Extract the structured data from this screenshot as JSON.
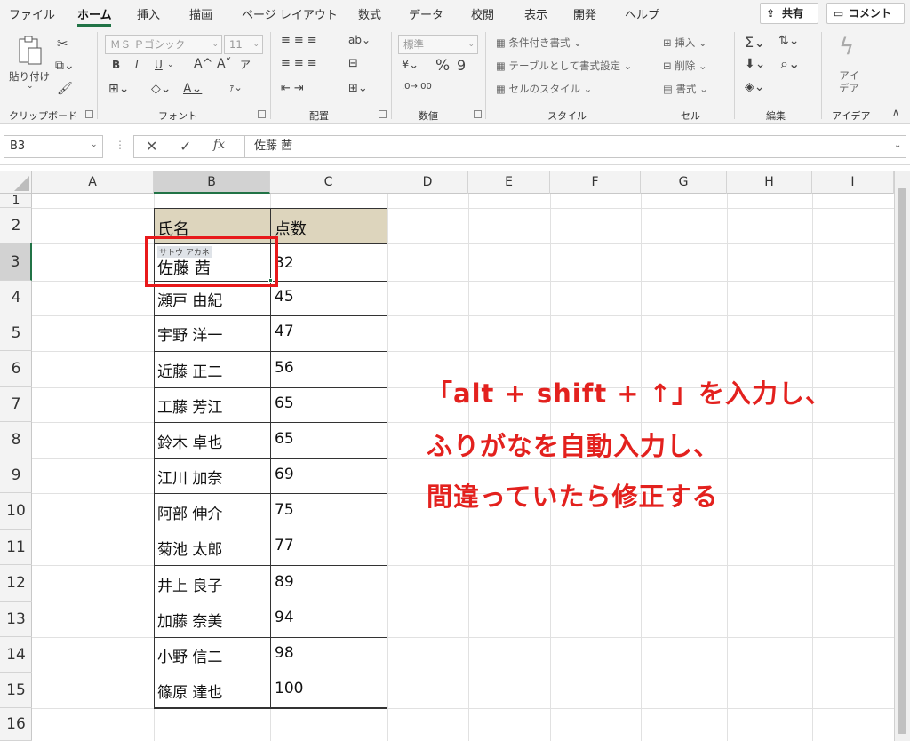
{
  "ribbon_tabs": [
    "ファイル",
    "ホーム",
    "挿入",
    "描画",
    "ページ レイアウト",
    "数式",
    "データ",
    "校閲",
    "表示",
    "開発",
    "ヘルプ"
  ],
  "share_button": "共有",
  "comment_button": "コメント",
  "clipboard": {
    "paste": "貼り付け",
    "label": "クリップボード"
  },
  "font_group": {
    "font_name": "ＭＳ Ｐゴシック",
    "font_size": "11",
    "label": "フォント",
    "bold": "B",
    "italic": "I",
    "underline": "U",
    "grow": "A^",
    "shrink": "Aˇ"
  },
  "alignment_group": {
    "label": "配置"
  },
  "number_group": {
    "format": "標準",
    "label": "数値",
    "percent": "%",
    "comma": "9"
  },
  "styles_group": {
    "conditional": "条件付き書式",
    "table": "テーブルとして書式設定",
    "cell_styles": "セルのスタイル",
    "label": "スタイル"
  },
  "cells_group": {
    "insert": "挿入",
    "delete": "削除",
    "format": "書式",
    "label": "セル"
  },
  "edit_group": {
    "label": "編集"
  },
  "ideas_group": {
    "button": "アイ\nデア",
    "label": "アイデア"
  },
  "formula_bar": {
    "name_box": "B3",
    "fx": "fx",
    "content": "佐藤 茜"
  },
  "columns": [
    "A",
    "B",
    "C",
    "D",
    "E",
    "F",
    "G",
    "H",
    "I"
  ],
  "rows": [
    "1",
    "2",
    "3",
    "4",
    "5",
    "6",
    "7",
    "8",
    "9",
    "10",
    "11",
    "12",
    "13",
    "14",
    "15",
    "16"
  ],
  "table": {
    "headers": [
      "氏名",
      "点数"
    ],
    "rows": [
      [
        "佐藤 茜",
        "32"
      ],
      [
        "瀬戸 由紀",
        "45"
      ],
      [
        "宇野 洋一",
        "47"
      ],
      [
        "近藤 正二",
        "56"
      ],
      [
        "工藤 芳江",
        "65"
      ],
      [
        "鈴木 卓也",
        "65"
      ],
      [
        "江川 加奈",
        "69"
      ],
      [
        "阿部 伸介",
        "75"
      ],
      [
        "菊池 太郎",
        "77"
      ],
      [
        "井上 良子",
        "89"
      ],
      [
        "加藤 奈美",
        "94"
      ],
      [
        "小野 信二",
        "98"
      ],
      [
        "篠原 達也",
        "100"
      ]
    ],
    "furigana": "サトウ  アカネ"
  },
  "annotation": [
    "「alt + shift + ↑」を入力し、",
    "ふりがなを自動入力し、",
    "間違っていたら修正する"
  ],
  "colors": {
    "accent": "#217346",
    "header_fill": "#ddd5bd",
    "annotation": "#e3211e"
  }
}
